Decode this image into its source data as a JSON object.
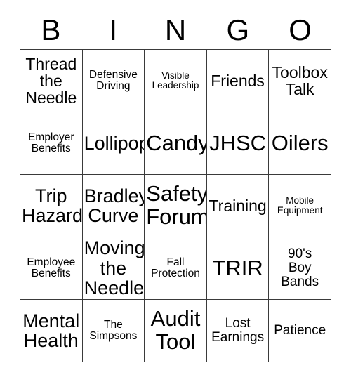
{
  "card": {
    "title": "BINGO",
    "header_letters": [
      "B",
      "I",
      "N",
      "G",
      "O"
    ],
    "grid_size": "5x5",
    "text_color": "#000000",
    "border_color": "#3a3a3a",
    "background_color": "#ffffff",
    "rows": [
      [
        {
          "text": "Thread\nthe\nNeedle",
          "size": "lg"
        },
        {
          "text": "Defensive\nDriving",
          "size": "sm"
        },
        {
          "text": "Visible\nLeadership",
          "size": "xs"
        },
        {
          "text": "Friends",
          "size": "lg"
        },
        {
          "text": "Toolbox\nTalk",
          "size": "lg"
        }
      ],
      [
        {
          "text": "Employer\nBenefits",
          "size": "sm"
        },
        {
          "text": "Lollipop",
          "size": "xl"
        },
        {
          "text": "Candy",
          "size": "xxl"
        },
        {
          "text": "JHSC",
          "size": "xxl"
        },
        {
          "text": "Oilers",
          "size": "xxl"
        }
      ],
      [
        {
          "text": "Trip\nHazard",
          "size": "xl"
        },
        {
          "text": "Bradley\nCurve",
          "size": "xl"
        },
        {
          "text": "Safety\nForum",
          "size": "xxl"
        },
        {
          "text": "Training",
          "size": "lg"
        },
        {
          "text": "Mobile\nEquipment",
          "size": "xs"
        }
      ],
      [
        {
          "text": "Employee\nBenefits",
          "size": "sm"
        },
        {
          "text": "Moving\nthe\nNeedle",
          "size": "xl"
        },
        {
          "text": "Fall\nProtection",
          "size": "sm"
        },
        {
          "text": "TRIR",
          "size": "xxl"
        },
        {
          "text": "90's\nBoy\nBands",
          "size": "md"
        }
      ],
      [
        {
          "text": "Mental\nHealth",
          "size": "xl"
        },
        {
          "text": "The\nSimpsons",
          "size": "sm"
        },
        {
          "text": "Audit\nTool",
          "size": "xxl"
        },
        {
          "text": "Lost\nEarnings",
          "size": "md"
        },
        {
          "text": "Patience",
          "size": "md"
        }
      ]
    ]
  }
}
